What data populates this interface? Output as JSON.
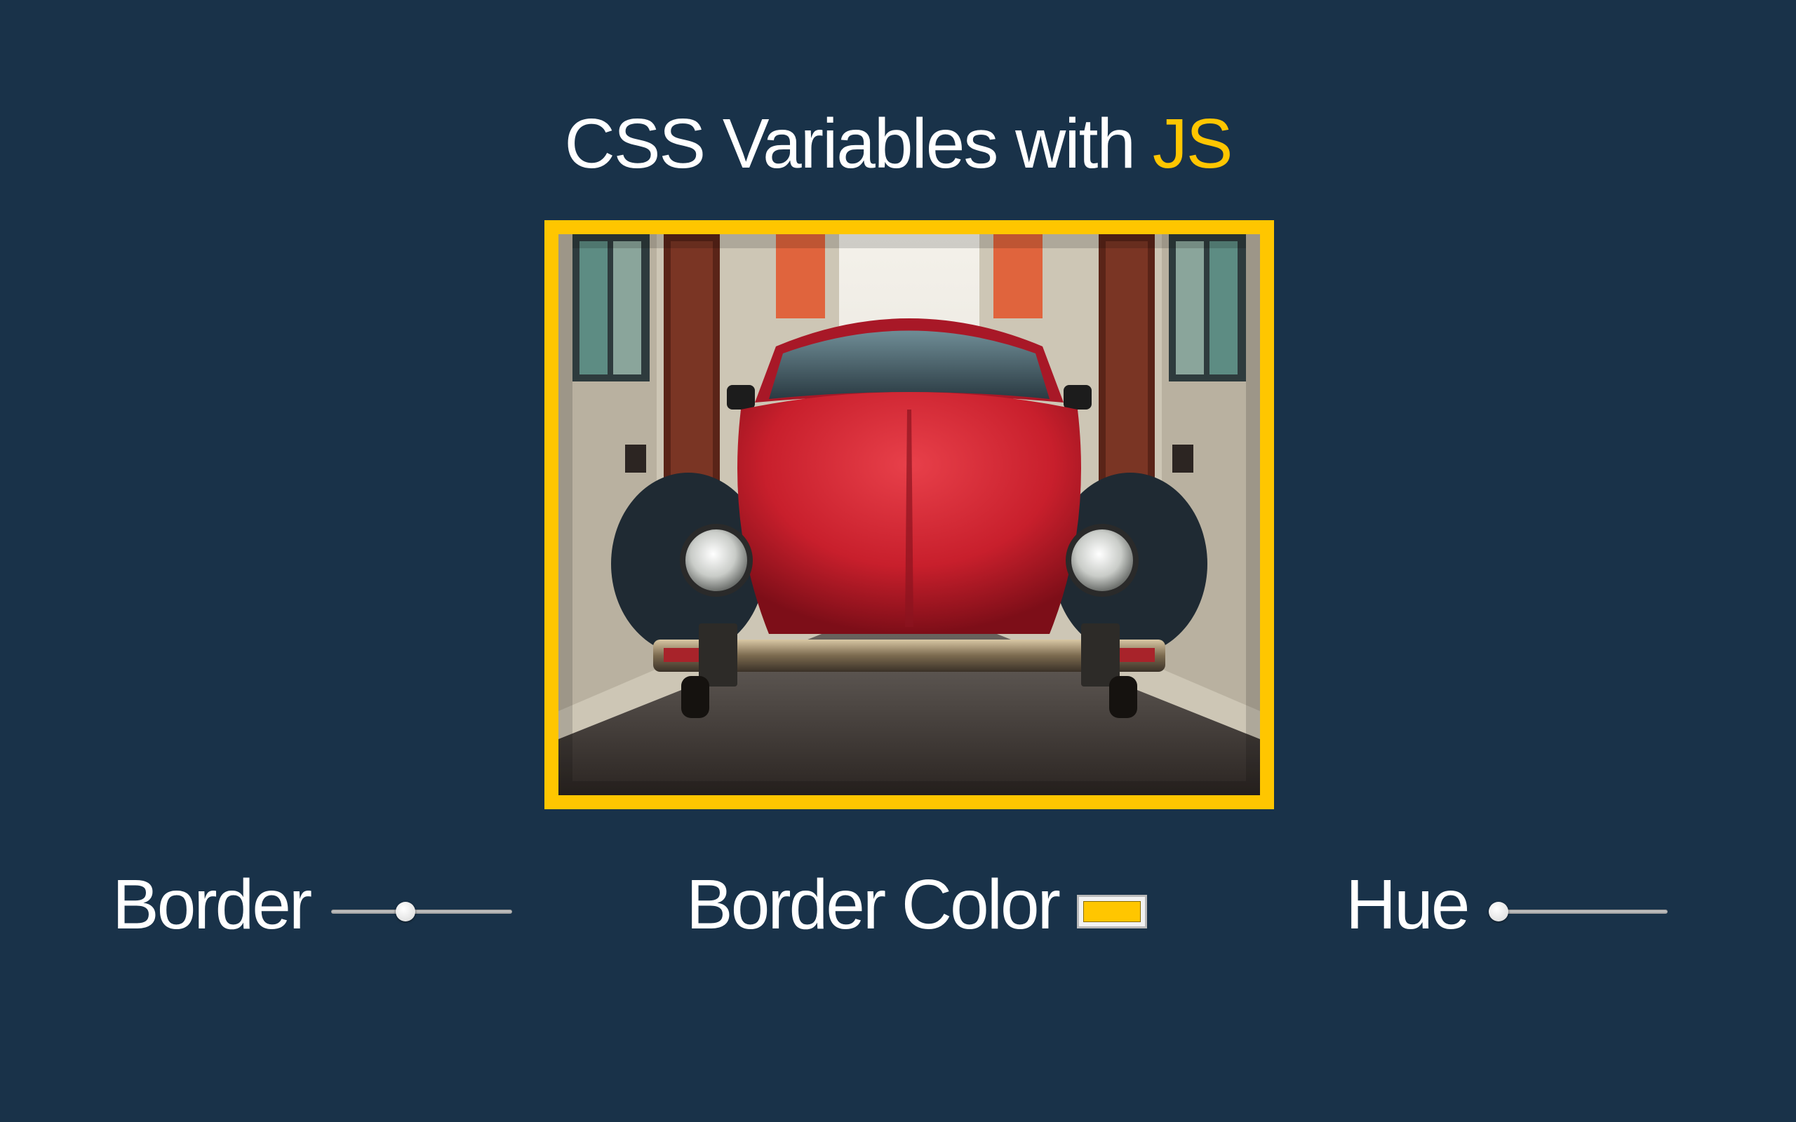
{
  "page": {
    "title_main": "CSS Variables with",
    "title_highlight": "JS"
  },
  "image": {
    "subject": "red-vintage-beetle-car-photo",
    "border_color": "#ffc600"
  },
  "controls": {
    "border": {
      "label": "Border",
      "value": 0.4
    },
    "border_color": {
      "label": "Border Color",
      "value": "#ffc600"
    },
    "hue": {
      "label": "Hue",
      "value": 0.0
    }
  },
  "colors": {
    "background": "#193249",
    "accent": "#ffc600",
    "text": "#ffffff"
  }
}
